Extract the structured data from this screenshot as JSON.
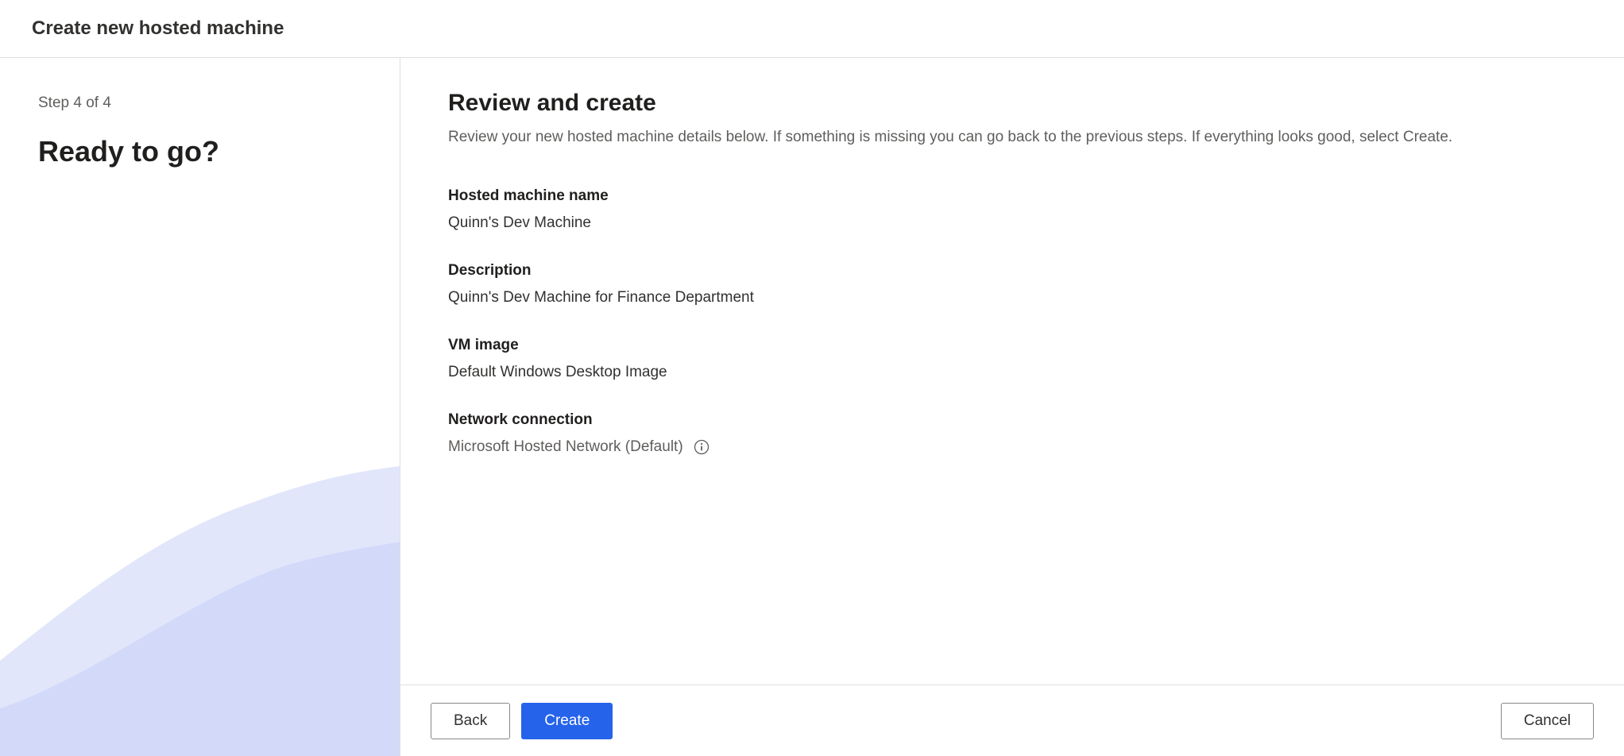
{
  "header": {
    "title": "Create new hosted machine"
  },
  "sidebar": {
    "step": "Step 4 of 4",
    "title": "Ready to go?"
  },
  "main": {
    "title": "Review and create",
    "subtitle": "Review your new hosted machine details below. If something is missing you can go back to the previous steps. If everything looks good, select Create.",
    "fields": {
      "machine_name": {
        "label": "Hosted machine name",
        "value": "Quinn's Dev Machine"
      },
      "description": {
        "label": "Description",
        "value": "Quinn's Dev Machine for Finance Department"
      },
      "vm_image": {
        "label": "VM image",
        "value": "Default Windows Desktop Image"
      },
      "network": {
        "label": "Network connection",
        "value": "Microsoft Hosted Network (Default)"
      }
    }
  },
  "footer": {
    "back": "Back",
    "create": "Create",
    "cancel": "Cancel"
  }
}
